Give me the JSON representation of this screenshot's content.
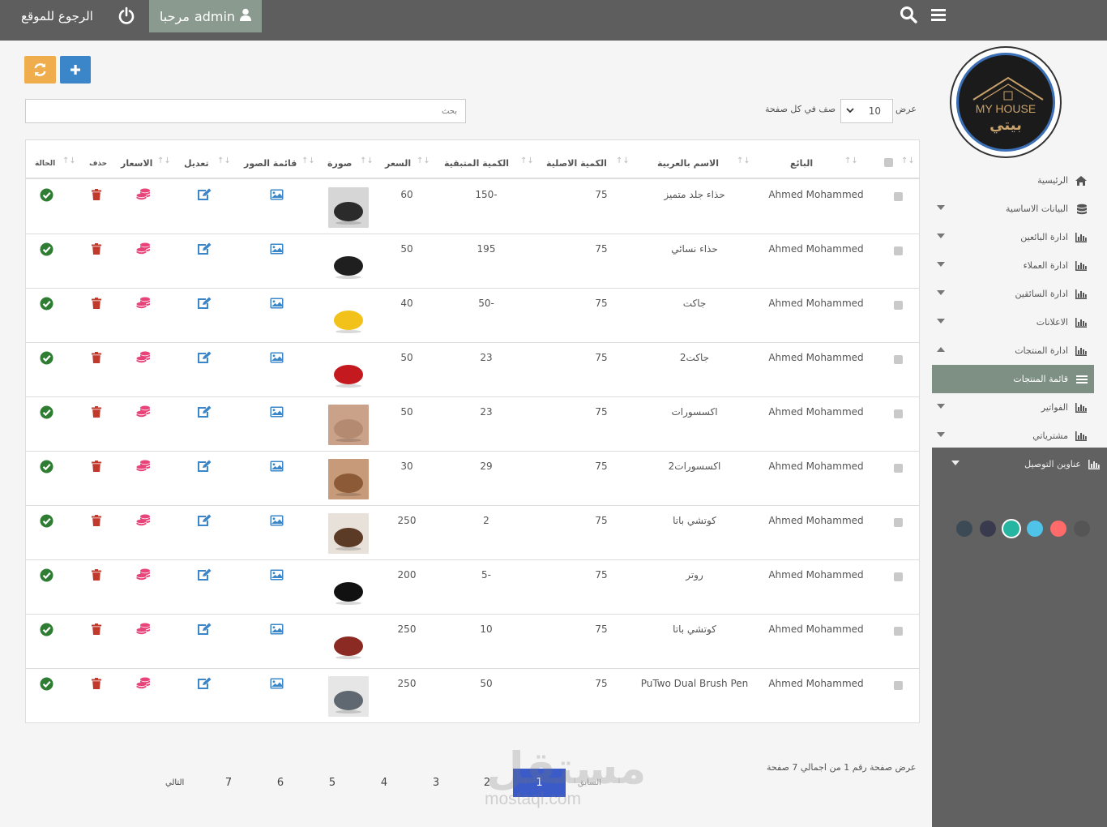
{
  "topbar": {
    "back_label": "الرجوع للموقع",
    "welcome_label": "مرحبا",
    "username": "admin",
    "power_icon": "power-icon",
    "user_icon": "user-icon",
    "search_icon": "search-icon",
    "menu_icon": "hamburger-icon"
  },
  "logo": {
    "text_en": "MY HOUSE",
    "text_ar": "بيتي"
  },
  "sidebar": {
    "items": [
      {
        "label": "الرئيسية",
        "icon": "home-icon",
        "caret": ""
      },
      {
        "label": "البيانات الاساسية",
        "icon": "database-icon",
        "caret": "down"
      },
      {
        "label": "ادارة البائعين",
        "icon": "bar-chart-icon",
        "caret": "down"
      },
      {
        "label": "ادارة العملاء",
        "icon": "bar-chart-icon",
        "caret": "down"
      },
      {
        "label": "ادارة السائقين",
        "icon": "bar-chart-icon",
        "caret": "down"
      },
      {
        "label": "الاعلانات",
        "icon": "bar-chart-icon",
        "caret": "down"
      },
      {
        "label": "ادارة المنتجات",
        "icon": "bar-chart-icon",
        "caret": "up"
      },
      {
        "label": "قائمة المنتجات",
        "icon": "list-icon",
        "caret": "",
        "active": true
      },
      {
        "label": "الفواتير",
        "icon": "bar-chart-icon",
        "caret": "down"
      },
      {
        "label": "مشترياتي",
        "icon": "bar-chart-icon",
        "caret": "down"
      },
      {
        "label": "عناوين التوصيل",
        "icon": "bar-chart-icon",
        "caret": "down"
      }
    ],
    "theme_colors": [
      "#555555",
      "#ff6b6b",
      "#4fc3e8",
      "#26b5a0",
      "#3a3a4f",
      "#3c4a55"
    ]
  },
  "toolbar": {
    "refresh_icon": "refresh-icon",
    "add_icon": "plus-icon"
  },
  "search": {
    "placeholder": "بحث"
  },
  "page_size": {
    "show_label": "عرض",
    "value": "10",
    "rows_label": "صف في كل صفحة"
  },
  "table": {
    "headers": {
      "seller": "البائع",
      "name_ar": "الاسم بالعربية",
      "qty_original": "الكمية الاصلية",
      "qty_remaining": "الكمية المتبقية",
      "price": "السعر",
      "image": "صورة",
      "images_list": "قائمة الصور",
      "edit": "تعديل",
      "prices": "الاسعار",
      "delete": "حذف",
      "status": "الحالة"
    },
    "rows": [
      {
        "seller": "Ahmed Mohammed",
        "name_ar": "حذاء جلد متميز",
        "qty_original": "75",
        "qty_remaining": "150-",
        "price": "60",
        "thumb_color": "#2b2b2b",
        "thumb_bg": "#d6d6d6"
      },
      {
        "seller": "Ahmed Mohammed",
        "name_ar": "حذاء نسائي",
        "qty_original": "75",
        "qty_remaining": "195",
        "price": "50",
        "thumb_color": "#1f1f1f",
        "thumb_bg": "#ffffff"
      },
      {
        "seller": "Ahmed Mohammed",
        "name_ar": "جاكت",
        "qty_original": "75",
        "qty_remaining": "50-",
        "price": "40",
        "thumb_color": "#f2c21b",
        "thumb_bg": "#ffffff"
      },
      {
        "seller": "Ahmed Mohammed",
        "name_ar": "جاكت2",
        "qty_original": "75",
        "qty_remaining": "23",
        "price": "50",
        "thumb_color": "#c4191f",
        "thumb_bg": "#ffffff"
      },
      {
        "seller": "Ahmed Mohammed",
        "name_ar": "اكسسورات",
        "qty_original": "75",
        "qty_remaining": "23",
        "price": "50",
        "thumb_color": "#b48a70",
        "thumb_bg": "#caa28a"
      },
      {
        "seller": "Ahmed Mohammed",
        "name_ar": "اكسسورات2",
        "qty_original": "75",
        "qty_remaining": "29",
        "price": "30",
        "thumb_color": "#8c5a36",
        "thumb_bg": "#c79b7a"
      },
      {
        "seller": "Ahmed Mohammed",
        "name_ar": "كوتشي باتا",
        "qty_original": "75",
        "qty_remaining": "2",
        "price": "250",
        "thumb_color": "#5b3a26",
        "thumb_bg": "#e8e1da"
      },
      {
        "seller": "Ahmed Mohammed",
        "name_ar": "روتر",
        "qty_original": "75",
        "qty_remaining": "5-",
        "price": "200",
        "thumb_color": "#111111",
        "thumb_bg": "#ffffff"
      },
      {
        "seller": "Ahmed Mohammed",
        "name_ar": "كوتشي باتا",
        "qty_original": "75",
        "qty_remaining": "10",
        "price": "250",
        "thumb_color": "#8b2a22",
        "thumb_bg": "#ffffff"
      },
      {
        "seller": "Ahmed Mohammed",
        "name_ar": "PuTwo Dual Brush Pen",
        "qty_original": "75",
        "qty_remaining": "50",
        "price": "250",
        "thumb_color": "#5f6770",
        "thumb_bg": "#e6e6e6"
      }
    ],
    "row_icons": {
      "images": "image-icon",
      "edit": "edit-icon",
      "prices": "coins-icon",
      "delete": "trash-icon",
      "status": "check-circle-icon"
    },
    "colors": {
      "blue": "#3a86c8",
      "pink": "#e8447a",
      "red": "#c0392b",
      "green": "#2e7d32"
    }
  },
  "pagination": {
    "info": "عرض صفحة رقم 1 من اجمالي 7 صفحة",
    "prev": "السابق",
    "next": "التالي",
    "pages": [
      "1",
      "2",
      "3",
      "4",
      "5",
      "6",
      "7"
    ],
    "active": "1"
  },
  "watermark": {
    "text_ar": "مستقل",
    "text_en": "mostaql.com"
  }
}
